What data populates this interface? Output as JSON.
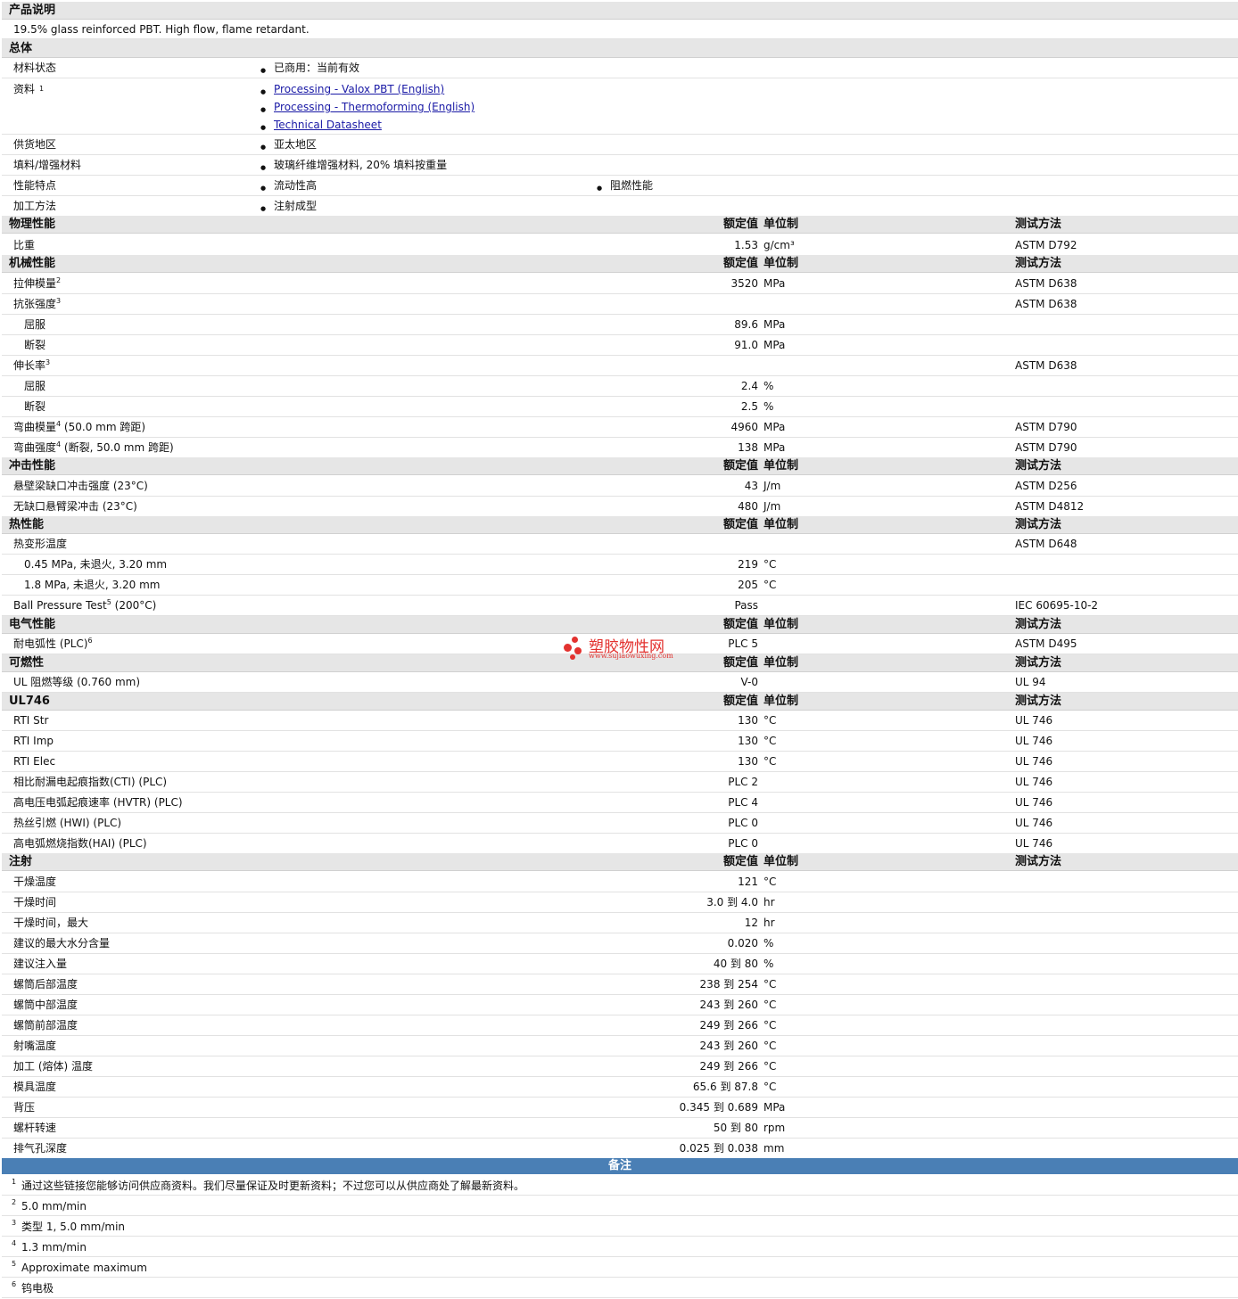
{
  "description": {
    "header": "产品说明",
    "text": "19.5% glass reinforced PBT. High flow, flame retardant."
  },
  "general": {
    "header": "总体",
    "material_status": {
      "label": "材料状态",
      "value": "已商用：当前有效"
    },
    "resources": {
      "label": "资料",
      "sup": "1",
      "links": [
        "Processing - Valox PBT (English)",
        "Processing - Thermoforming (English)",
        "Technical Datasheet"
      ]
    },
    "supply_region": {
      "label": "供货地区",
      "value": "亚太地区"
    },
    "filler": {
      "label": "填料/增强材料",
      "value": "玻璃纤维增强材料, 20% 填料按重量"
    },
    "features": {
      "label": "性能特点",
      "values": [
        "流动性高",
        "阻燃性能"
      ]
    },
    "processing": {
      "label": "加工方法",
      "value": "注射成型"
    }
  },
  "col_headers": {
    "value": "额定值",
    "unit": "单位制",
    "test": "测试方法"
  },
  "physical": {
    "header": "物理性能",
    "rows": [
      {
        "label": "比重",
        "value": "1.53",
        "unit": "g/cm³",
        "test": "ASTM D792"
      }
    ]
  },
  "mechanical": {
    "header": "机械性能",
    "rows": [
      {
        "label": "拉伸模量",
        "sup": "2",
        "value": "3520",
        "unit": "MPa",
        "test": "ASTM D638"
      },
      {
        "label": "抗张强度",
        "sup": "3",
        "value": "",
        "unit": "",
        "test": "ASTM D638"
      },
      {
        "label": "屈服",
        "sub": true,
        "value": "89.6",
        "unit": "MPa",
        "test": ""
      },
      {
        "label": "断裂",
        "sub": true,
        "value": "91.0",
        "unit": "MPa",
        "test": ""
      },
      {
        "label": "伸长率",
        "sup": "3",
        "value": "",
        "unit": "",
        "test": "ASTM D638"
      },
      {
        "label": "屈服",
        "sub": true,
        "value": "2.4",
        "unit": "%",
        "test": ""
      },
      {
        "label": "断裂",
        "sub": true,
        "value": "2.5",
        "unit": "%",
        "test": ""
      },
      {
        "label": "弯曲模量",
        "sup": "4",
        "suffix": " (50.0 mm 跨距)",
        "value": "4960",
        "unit": "MPa",
        "test": "ASTM D790"
      },
      {
        "label": "弯曲强度",
        "sup": "4",
        "suffix": " (断裂, 50.0 mm 跨距)",
        "value": "138",
        "unit": "MPa",
        "test": "ASTM D790"
      }
    ]
  },
  "impact": {
    "header": "冲击性能",
    "rows": [
      {
        "label": "悬壁梁缺口冲击强度 (23°C)",
        "value": "43",
        "unit": "J/m",
        "test": "ASTM D256"
      },
      {
        "label": "无缺口悬臂梁冲击 (23°C)",
        "value": "480",
        "unit": "J/m",
        "test": "ASTM D4812"
      }
    ]
  },
  "thermal": {
    "header": "热性能",
    "rows": [
      {
        "label": "热变形温度",
        "value": "",
        "unit": "",
        "test": "ASTM D648"
      },
      {
        "label": "0.45 MPa, 未退火, 3.20 mm",
        "sub": true,
        "value": "219",
        "unit": "°C",
        "test": ""
      },
      {
        "label": "1.8 MPa, 未退火, 3.20 mm",
        "sub": true,
        "value": "205",
        "unit": "°C",
        "test": ""
      },
      {
        "label": "Ball Pressure Test",
        "sup": "5",
        "suffix": " (200°C)",
        "value": "Pass",
        "unit": "",
        "test": "IEC 60695-10-2"
      }
    ]
  },
  "electrical": {
    "header": "电气性能",
    "rows": [
      {
        "label": "耐电弧性 (PLC)",
        "sup": "6",
        "value": "PLC 5",
        "unit": "",
        "test": "ASTM D495"
      }
    ]
  },
  "flammability": {
    "header": "可燃性",
    "rows": [
      {
        "label": "UL 阻燃等级 (0.760 mm)",
        "value": "V-0",
        "unit": "",
        "test": "UL 94"
      }
    ]
  },
  "ul746": {
    "header": "UL746",
    "rows": [
      {
        "label": "RTI Str",
        "value": "130",
        "unit": "°C",
        "test": "UL 746"
      },
      {
        "label": "RTI Imp",
        "value": "130",
        "unit": "°C",
        "test": "UL 746"
      },
      {
        "label": "RTI Elec",
        "value": "130",
        "unit": "°C",
        "test": "UL 746"
      },
      {
        "label": "相比耐漏电起痕指数(CTI) (PLC)",
        "value": "PLC 2",
        "unit": "",
        "test": "UL 746"
      },
      {
        "label": "高电压电弧起痕速率 (HVTR) (PLC)",
        "value": "PLC 4",
        "unit": "",
        "test": "UL 746"
      },
      {
        "label": "热丝引燃 (HWI) (PLC)",
        "value": "PLC 0",
        "unit": "",
        "test": "UL 746"
      },
      {
        "label": "高电弧燃烧指数(HAI) (PLC)",
        "value": "PLC 0",
        "unit": "",
        "test": "UL 746"
      }
    ]
  },
  "injection": {
    "header": "注射",
    "rows": [
      {
        "label": "干燥温度",
        "value": "121",
        "unit": "°C"
      },
      {
        "label": "干燥时间",
        "value": "3.0 到  4.0",
        "unit": "hr"
      },
      {
        "label": "干燥时间，最大",
        "value": "12",
        "unit": "hr"
      },
      {
        "label": "建议的最大水分含量",
        "value": "0.020",
        "unit": "%"
      },
      {
        "label": "建议注入量",
        "value": "40 到  80",
        "unit": "%"
      },
      {
        "label": "螺筒后部温度",
        "value": "238 到  254",
        "unit": "°C"
      },
      {
        "label": "螺筒中部温度",
        "value": "243 到  260",
        "unit": "°C"
      },
      {
        "label": "螺筒前部温度",
        "value": "249 到  266",
        "unit": "°C"
      },
      {
        "label": "射嘴温度",
        "value": "243 到  260",
        "unit": "°C"
      },
      {
        "label": "加工 (熔体) 温度",
        "value": "249 到  266",
        "unit": "°C"
      },
      {
        "label": "模具温度",
        "value": "65.6 到  87.8",
        "unit": "°C"
      },
      {
        "label": "背压",
        "value": "0.345 到  0.689",
        "unit": "MPa"
      },
      {
        "label": "螺杆转速",
        "value": "50 到  80",
        "unit": "rpm"
      },
      {
        "label": "排气孔深度",
        "value": "0.025 到  0.038",
        "unit": "mm"
      }
    ]
  },
  "notes": {
    "header": "备注",
    "items": [
      {
        "n": "1",
        "text": "通过这些链接您能够访问供应商资料。我们尽量保证及时更新资料；不过您可以从供应商处了解最新资料。"
      },
      {
        "n": "2",
        "text": "5.0 mm/min"
      },
      {
        "n": "3",
        "text": "类型 1, 5.0 mm/min"
      },
      {
        "n": "4",
        "text": "1.3 mm/min"
      },
      {
        "n": "5",
        "text": "Approximate maximum"
      },
      {
        "n": "6",
        "text": "钨电极"
      }
    ]
  },
  "watermark": {
    "name": "塑胶物性网",
    "url": "www.sujiaowuxing.com",
    "color": "#e3322f"
  }
}
